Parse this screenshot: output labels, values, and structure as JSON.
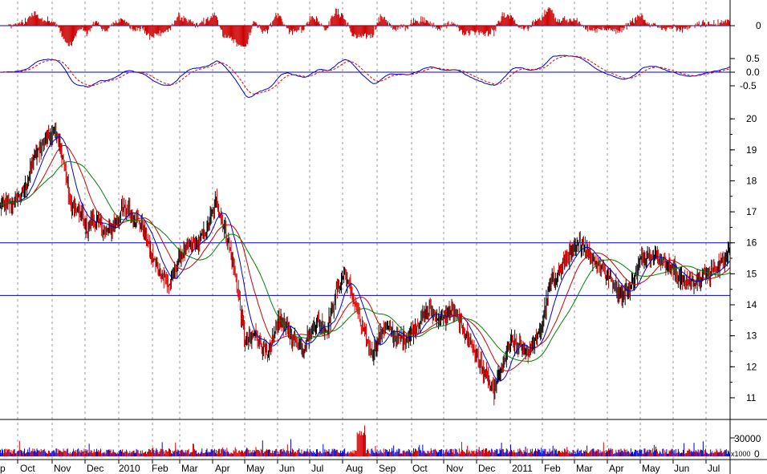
{
  "chart_data": {
    "type": "candlestick",
    "x_axis_labels": [
      "p",
      "Oct",
      "Nov",
      "Dec",
      "2010",
      "Feb",
      "Mar",
      "Apr",
      "May",
      "Jun",
      "Jul",
      "Aug",
      "Sep",
      "Oct",
      "Nov",
      "Dec",
      "2011",
      "Feb",
      "Mar",
      "Apr",
      "May",
      "Jun",
      "Jul"
    ],
    "price": {
      "ylim": [
        10.3,
        20.6
      ],
      "y_tick_labels": [
        "20",
        "19",
        "18",
        "17",
        "16",
        "15",
        "14",
        "13",
        "12",
        "11"
      ],
      "y_ticks": [
        20,
        19,
        18,
        17,
        16,
        15,
        14,
        13,
        12,
        11
      ],
      "horizontal_lines": [
        16.0,
        14.3
      ],
      "anchors": [
        [
          0,
          17.2
        ],
        [
          1,
          17.3
        ],
        [
          2,
          17.6
        ],
        [
          3,
          18.8
        ],
        [
          4,
          19.4
        ],
        [
          4.7,
          19.7
        ],
        [
          5.4,
          18.7
        ],
        [
          6,
          17.3
        ],
        [
          6.6,
          17.0
        ],
        [
          7,
          16.9
        ],
        [
          7.5,
          16.4
        ],
        [
          8,
          16.8
        ],
        [
          8.7,
          16.6
        ],
        [
          9,
          16.3
        ],
        [
          9.6,
          16.5
        ],
        [
          10.4,
          17.0
        ],
        [
          11,
          17.1
        ],
        [
          11.6,
          16.8
        ],
        [
          12.2,
          16.6
        ],
        [
          13,
          15.6
        ],
        [
          13.8,
          15.0
        ],
        [
          14.6,
          14.6
        ],
        [
          15.4,
          15.5
        ],
        [
          16.3,
          15.9
        ],
        [
          17,
          16.0
        ],
        [
          17.7,
          16.4
        ],
        [
          18.6,
          17.4
        ],
        [
          19.1,
          16.7
        ],
        [
          19.6,
          16.1
        ],
        [
          20.3,
          14.8
        ],
        [
          21.1,
          12.7
        ],
        [
          22,
          13.1
        ],
        [
          23,
          12.3
        ],
        [
          24,
          13.6
        ],
        [
          25,
          13.0
        ],
        [
          26,
          12.6
        ],
        [
          27.2,
          13.5
        ],
        [
          28.1,
          13.2
        ],
        [
          29,
          14.5
        ],
        [
          29.6,
          15.0
        ],
        [
          30.2,
          14.4
        ],
        [
          31,
          13.4
        ],
        [
          32,
          12.4
        ],
        [
          33,
          13.3
        ],
        [
          34,
          13.0
        ],
        [
          35,
          12.9
        ],
        [
          36.3,
          13.6
        ],
        [
          37,
          13.8
        ],
        [
          38,
          13.5
        ],
        [
          39,
          13.8
        ],
        [
          40,
          13.1
        ],
        [
          41,
          12.4
        ],
        [
          42,
          11.5
        ],
        [
          42.5,
          11.2
        ],
        [
          43.2,
          12.0
        ],
        [
          44,
          12.8
        ],
        [
          45.4,
          12.5
        ],
        [
          46.4,
          13.0
        ],
        [
          47.3,
          14.6
        ],
        [
          48.3,
          15.2
        ],
        [
          49,
          15.6
        ],
        [
          50,
          16.0
        ],
        [
          51,
          15.5
        ],
        [
          52,
          15.1
        ],
        [
          52.8,
          14.7
        ],
        [
          53.6,
          14.3
        ],
        [
          54.3,
          14.6
        ],
        [
          55.2,
          15.5
        ],
        [
          56,
          15.7
        ],
        [
          57,
          15.4
        ],
        [
          58,
          15.1
        ],
        [
          59,
          14.7
        ],
        [
          60,
          14.8
        ],
        [
          61,
          15.0
        ],
        [
          62,
          15.3
        ],
        [
          62.8,
          15.9
        ]
      ]
    },
    "volume": {
      "y_tick_labels": [
        "30000",
        "0"
      ],
      "y_ticks": [
        30000,
        0
      ],
      "multiplier_label": "x1000",
      "ylim": [
        0,
        60000
      ]
    },
    "macd": {
      "y_tick_labels": [
        "0.5",
        "0.0",
        "-0.5"
      ],
      "y_ticks": [
        0.5,
        0.0,
        -0.5
      ],
      "ylim": [
        -1.0,
        1.0
      ]
    },
    "histogram": {
      "y_tick_labels": [
        "0"
      ],
      "y_ticks": [
        0
      ],
      "ylim": [
        -1.0,
        1.0
      ]
    },
    "colors": {
      "up": "#000000",
      "down": "#e00000",
      "hline": "#0000cc",
      "ma_short": "#0000cc",
      "ma_mid": "#cc0000",
      "ma_long": "#008000",
      "grid": "#999999",
      "hist": "#cc0000"
    }
  }
}
